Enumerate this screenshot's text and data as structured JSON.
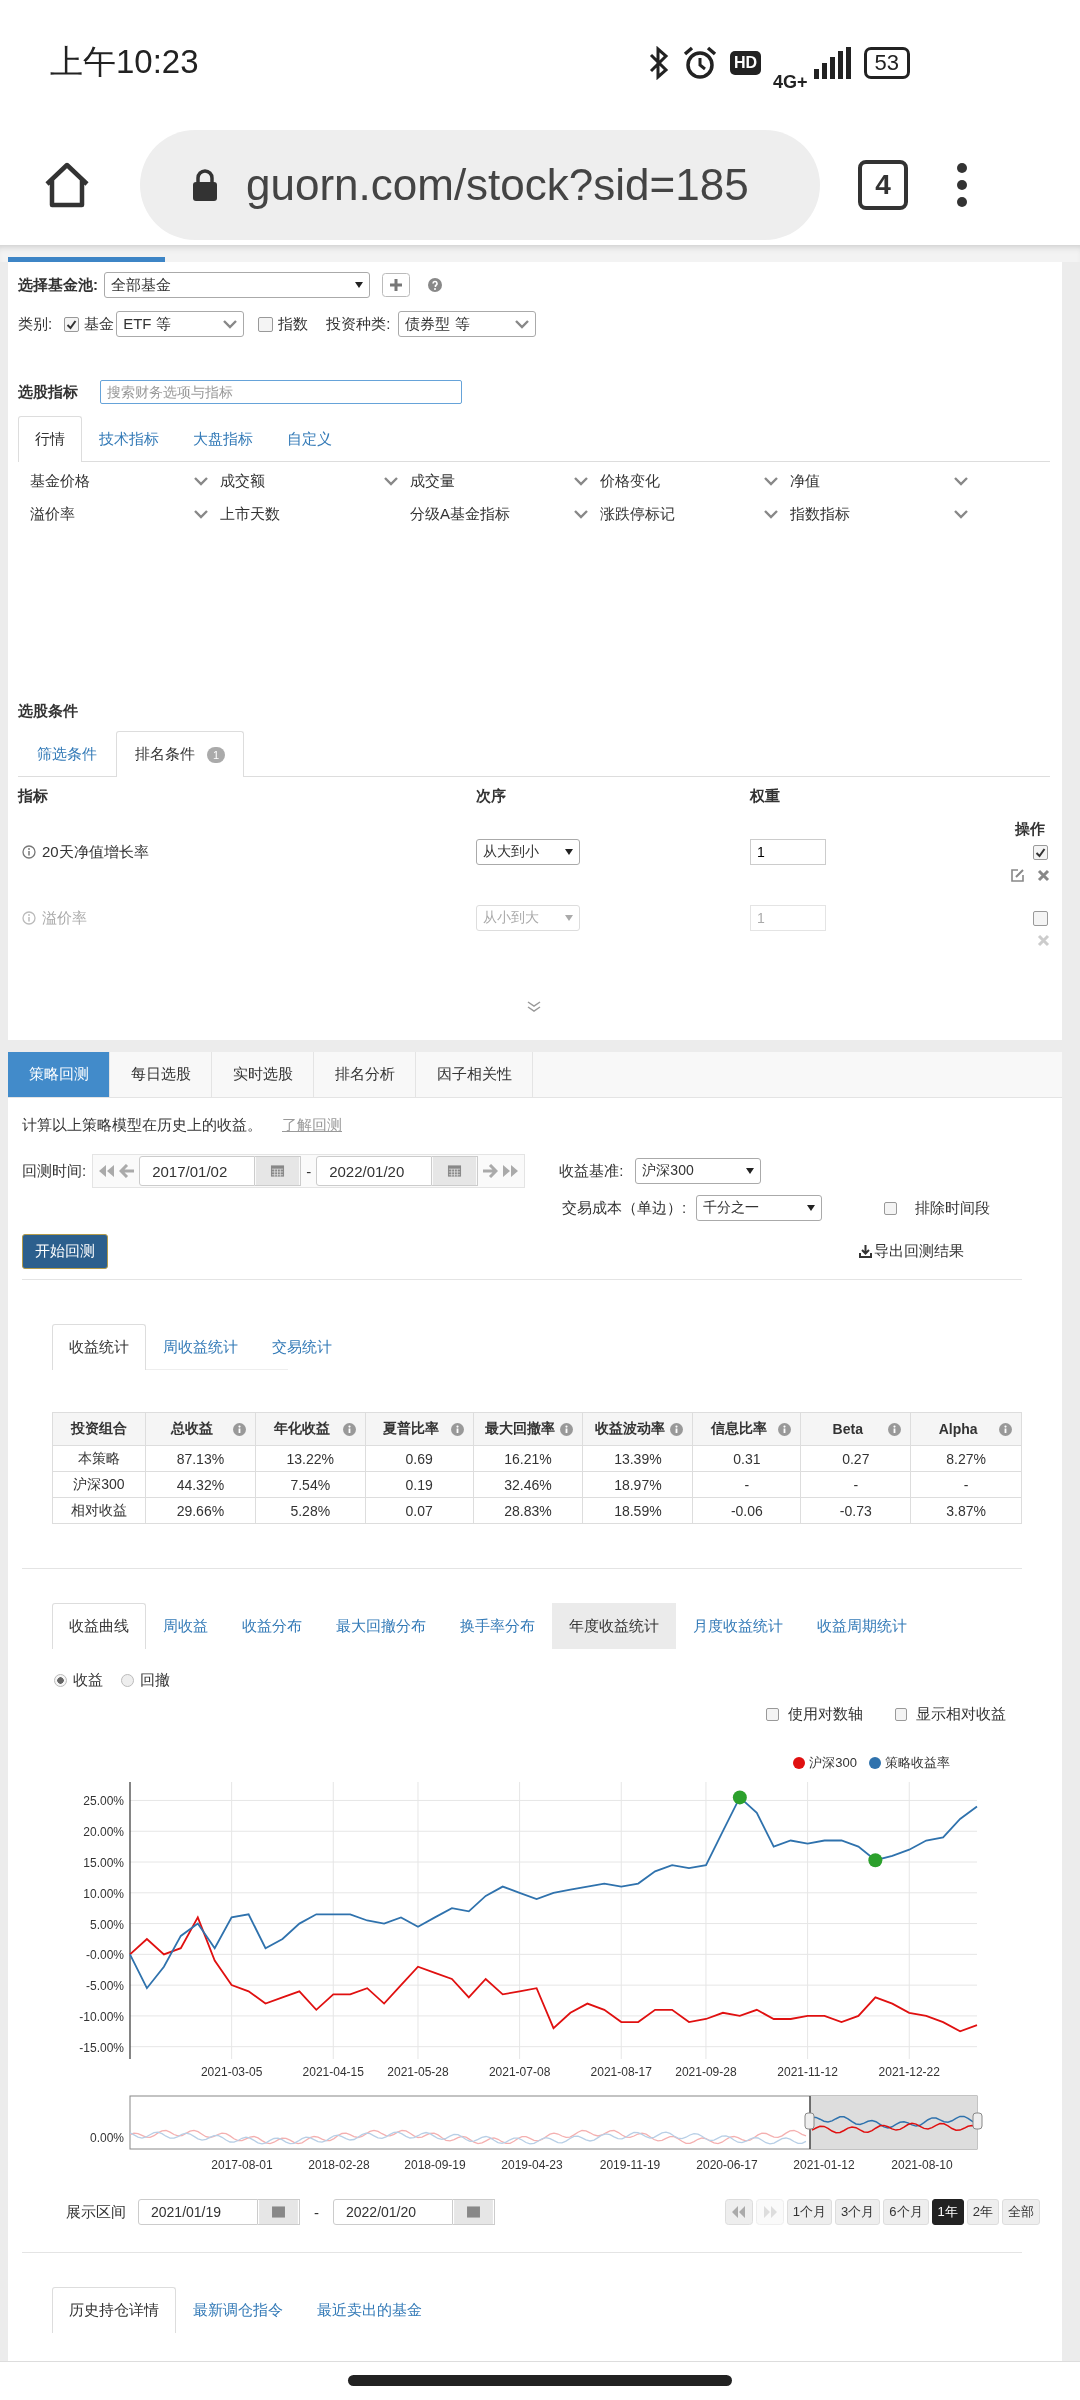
{
  "status_bar": {
    "time": "上午10:23",
    "hd": "HD",
    "network": "4G+",
    "battery": "53"
  },
  "browser": {
    "url": "guorn.com/stock?sid=185",
    "tab_count": "4"
  },
  "fund_pool": {
    "label": "选择基金池:",
    "value": "全部基金"
  },
  "category": {
    "label": "类别:",
    "fund": {
      "label": "基金",
      "checked": true
    },
    "fund_type": "ETF 等",
    "index": {
      "label": "指数",
      "checked": false
    },
    "invest_label": "投资种类:",
    "invest_value": "债券型 等"
  },
  "indicators": {
    "label": "选股指标",
    "search_placeholder": "搜索财务选项与指标",
    "tabs": [
      {
        "label": "行情",
        "selected": true
      },
      {
        "label": "技术指标",
        "selected": false
      },
      {
        "label": "大盘指标",
        "selected": false
      },
      {
        "label": "自定义",
        "selected": false
      }
    ],
    "items": [
      "基金价格",
      "成交额",
      "成交量",
      "价格变化",
      "净值",
      "溢价率",
      "上市天数",
      "分级A基金指标",
      "涨跌停标记",
      "指数指标"
    ],
    "item_dropdown": [
      true,
      true,
      true,
      true,
      true,
      true,
      false,
      true,
      true,
      true
    ]
  },
  "conditions": {
    "label": "选股条件",
    "tabs": [
      {
        "label": "筛选条件",
        "selected": false
      },
      {
        "label": "排名条件",
        "selected": true,
        "badge": "1"
      }
    ],
    "columns": [
      "指标",
      "次序",
      "权重",
      "操作"
    ],
    "rows": [
      {
        "name": "20天净值增长率",
        "order": "从大到小",
        "weight": "1",
        "enabled": true
      },
      {
        "name": "溢价率",
        "order": "从小到大",
        "weight": "1",
        "enabled": false
      }
    ]
  },
  "backtest": {
    "tabs": [
      {
        "label": "策略回测",
        "selected": true
      },
      {
        "label": "每日选股",
        "selected": false
      },
      {
        "label": "实时选股",
        "selected": false
      },
      {
        "label": "排名分析",
        "selected": false
      },
      {
        "label": "因子相关性",
        "selected": false
      }
    ],
    "description": "计算以上策略模型在历史上的收益。",
    "learn_link": "了解回测",
    "time_label": "回测时间:",
    "start_date": "2017/01/02",
    "separator": "-",
    "end_date": "2022/01/20",
    "benchmark_label": "收益基准:",
    "benchmark": "沪深300",
    "cost_label": "交易成本（单边）:",
    "cost": "千分之一",
    "exclude": {
      "label": "排除时间段",
      "checked": false
    },
    "run_button": "开始回测",
    "export": "导出回测结果"
  },
  "stats": {
    "tabs": [
      {
        "label": "收益统计",
        "selected": true
      },
      {
        "label": "周收益统计",
        "selected": false
      },
      {
        "label": "交易统计",
        "selected": false
      }
    ],
    "columns": [
      "投资组合",
      "总收益",
      "年化收益",
      "夏普比率",
      "最大回撤率",
      "收益波动率",
      "信息比率",
      "Beta",
      "Alpha"
    ],
    "rows": [
      [
        "本策略",
        "87.13%",
        "13.22%",
        "0.69",
        "16.21%",
        "13.39%",
        "0.31",
        "0.27",
        "8.27%"
      ],
      [
        "沪深300",
        "44.32%",
        "7.54%",
        "0.19",
        "32.46%",
        "18.97%",
        "-",
        "-",
        "-"
      ],
      [
        "相对收益",
        "29.66%",
        "5.28%",
        "0.07",
        "28.83%",
        "18.59%",
        "-0.06",
        "-0.73",
        "3.87%"
      ]
    ]
  },
  "curve": {
    "tabs": [
      {
        "label": "收益曲线",
        "selected": true,
        "highlighted": false
      },
      {
        "label": "周收益",
        "selected": false,
        "highlighted": false
      },
      {
        "label": "收益分布",
        "selected": false,
        "highlighted": false
      },
      {
        "label": "最大回撤分布",
        "selected": false,
        "highlighted": false
      },
      {
        "label": "换手率分布",
        "selected": false,
        "highlighted": false
      },
      {
        "label": "年度收益统计",
        "selected": false,
        "highlighted": true
      },
      {
        "label": "月度收益统计",
        "selected": false,
        "highlighted": false
      },
      {
        "label": "收益周期统计",
        "selected": false,
        "highlighted": false
      }
    ],
    "modes": [
      {
        "label": "收益",
        "selected": true
      },
      {
        "label": "回撤",
        "selected": false
      }
    ],
    "options": [
      {
        "label": "使用对数轴",
        "checked": false
      },
      {
        "label": "显示相对收益",
        "checked": false
      }
    ],
    "chart_data": {
      "type": "line",
      "categories": [
        null,
        null,
        null,
        null,
        null,
        null,
        "2021-03-05",
        null,
        null,
        null,
        null,
        null,
        "2021-04-15",
        null,
        null,
        null,
        null,
        "2021-05-28",
        null,
        null,
        null,
        null,
        null,
        "2021-07-08",
        null,
        null,
        null,
        null,
        null,
        "2021-08-17",
        null,
        null,
        null,
        null,
        "2021-09-28",
        null,
        null,
        null,
        null,
        null,
        "2021-11-12",
        null,
        null,
        null,
        null,
        null,
        "2021-12-22",
        null,
        null,
        null,
        null
      ],
      "ylim": [
        -17,
        28
      ],
      "yticks": [
        {
          "value": 25,
          "label": "25.00%"
        },
        {
          "value": 20,
          "label": "20.00%"
        },
        {
          "value": 15,
          "label": "15.00%"
        },
        {
          "value": 10,
          "label": "10.00%"
        },
        {
          "value": 5,
          "label": "5.00%"
        },
        {
          "value": 0,
          "label": "-0.00%"
        },
        {
          "value": -5,
          "label": "-5.00%"
        },
        {
          "value": -10,
          "label": "-10.00%"
        },
        {
          "value": -15,
          "label": "-15.00%"
        }
      ],
      "series": [
        {
          "name": "沪深300",
          "color": "#e01010",
          "values": [
            0,
            2.5,
            0,
            1,
            6,
            -1,
            -5,
            -6,
            -8,
            -7,
            -6,
            -9,
            -6.5,
            -6.5,
            -5.5,
            -8,
            -5,
            -2,
            -3,
            -4,
            -7,
            -4,
            -6.5,
            -6,
            -5.5,
            -12,
            -9.5,
            -8,
            -9,
            -11,
            -11,
            -9,
            -9,
            -11,
            -10.5,
            -9.5,
            -10,
            -9,
            -10.5,
            -10.5,
            -10,
            -10,
            -11,
            -10,
            -7,
            -8,
            -9.5,
            -10,
            -11,
            -12.5,
            -11.5
          ]
        },
        {
          "name": "策略收益率",
          "color": "#2f72ad",
          "values": [
            0,
            -5.5,
            -2,
            3,
            5,
            1,
            6,
            6.5,
            1,
            2.5,
            5,
            6.5,
            6.5,
            6.5,
            5.5,
            5,
            6,
            4.5,
            6,
            7.5,
            7,
            9.5,
            11,
            10,
            9,
            10,
            10.5,
            11,
            11.5,
            11,
            11.5,
            13.5,
            14.5,
            14,
            14.5,
            20,
            25.5,
            23,
            17.5,
            18.5,
            18,
            18.5,
            18.5,
            17.5,
            15.3,
            16,
            17,
            18.5,
            19,
            22,
            24
          ]
        }
      ],
      "grid": true
    },
    "max_drawdown_markers": true,
    "navigator": {
      "axis_label": "0.00%",
      "dates": [
        "2017-08-01",
        "2018-02-28",
        "2018-09-19",
        "2019-04-23",
        "2019-11-19",
        "2020-06-17",
        "2021-01-12",
        "2021-08-10"
      ]
    },
    "range": {
      "label": "展示区间",
      "start": "2021/01/19",
      "separator": "-",
      "end": "2022/01/20",
      "buttons": [
        {
          "label": "1个月",
          "selected": false
        },
        {
          "label": "3个月",
          "selected": false
        },
        {
          "label": "6个月",
          "selected": false
        },
        {
          "label": "1年",
          "selected": true
        },
        {
          "label": "2年",
          "selected": false
        },
        {
          "label": "全部",
          "selected": false
        }
      ]
    }
  },
  "holdings": {
    "tabs": [
      {
        "label": "历史持仓详情",
        "selected": true
      },
      {
        "label": "最新调仓指令",
        "selected": false
      },
      {
        "label": "最近卖出的基金",
        "selected": false
      }
    ]
  }
}
